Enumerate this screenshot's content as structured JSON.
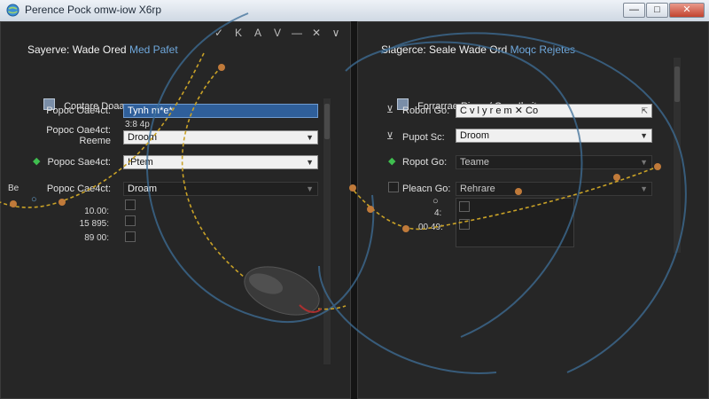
{
  "window": {
    "title": "Perence Pock omw-iow X6rp",
    "buttons": {
      "minimize": "—",
      "maximize": "□",
      "close": "✕"
    }
  },
  "left_panel": {
    "title_main": "Sayerve: Wade Ored",
    "title_accent": "Med Pafet",
    "toolbar": [
      "✓",
      "K",
      "A",
      "V",
      "—",
      "✕",
      "∨"
    ],
    "section_title": "Contare Doaacs",
    "rows": [
      {
        "label": "Popoc Oae4ct:",
        "value": "Tynh m*e*"
      },
      {
        "label": "Popoc Oae4ct:",
        "sublabel": "Reeme",
        "extra": "3:8 4p",
        "value": "Droom"
      },
      {
        "label": "Popoc Sae4ct:",
        "value": "IPtem"
      },
      {
        "label": "Popoc Cae4ct:",
        "prefix": "Be",
        "value": "Droam"
      }
    ],
    "small_values": [
      "10.00:",
      "15 895:",
      "89 00:"
    ]
  },
  "right_panel": {
    "title_main": "Slagerce: Seale Wade Ord",
    "title_accent": "Moqc Rejetes",
    "section_title": "Forrarrae Ringe / Ores Iheites",
    "rows": [
      {
        "label": "Robon Go:",
        "value": "C v l y r e m ✕ Co"
      },
      {
        "label": "Pupot Sc:",
        "value": "Droom"
      },
      {
        "label": "Ropot Go:",
        "value": "Teame"
      },
      {
        "label": "Pleacn Go:",
        "value": "Rehrare"
      }
    ],
    "small_values": [
      "4:",
      "00 49:"
    ]
  },
  "colors": {
    "accent": "#6fa8dc",
    "selection": "#2f5f9a",
    "curve": "#c9a227",
    "curve_dot": "#c07a3a",
    "ring": "#3e6f98"
  },
  "icons": {
    "app": "app-globe-icon",
    "section": "section-doc-icon",
    "mouse": "computer-mouse-icon"
  }
}
